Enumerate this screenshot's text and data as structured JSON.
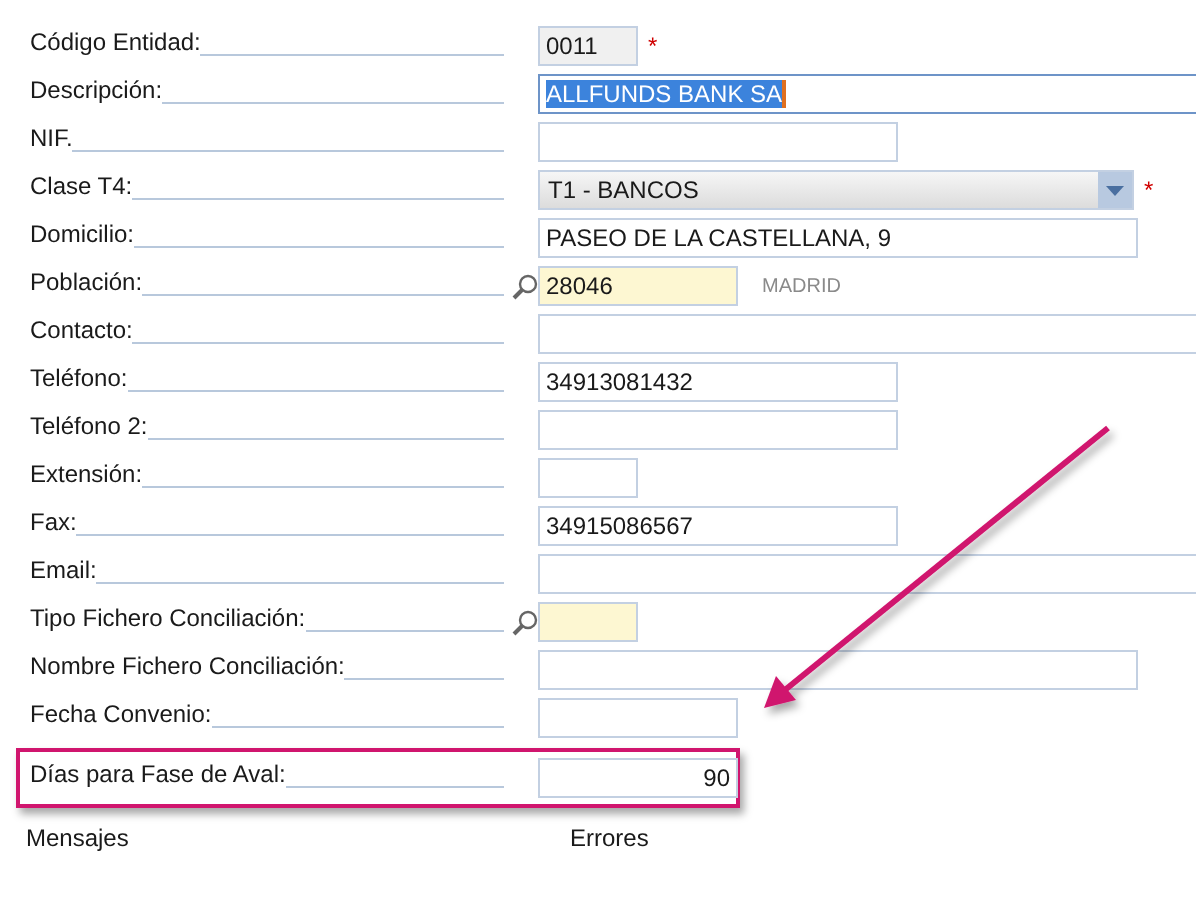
{
  "form": {
    "fields": [
      {
        "label": "Código Entidad:",
        "kind": "text",
        "value": "0011",
        "read_only": true,
        "marker": "*"
      },
      {
        "label": "Descripción:",
        "kind": "text",
        "value": "ALLFUNDS BANK SA",
        "selected": true
      },
      {
        "label": "NIF.",
        "kind": "text"
      },
      {
        "label": "Clase T4:",
        "kind": "select",
        "value": "T1 - BANCOS",
        "marker": "*"
      },
      {
        "label": "Domicilio:",
        "kind": "text",
        "value": "PASEO DE LA CASTELLANA, 9"
      },
      {
        "label": "Población:",
        "kind": "lookup",
        "value": "28046",
        "note": "MADRID"
      },
      {
        "label": "Contacto:",
        "kind": "text"
      },
      {
        "label": "Teléfono:",
        "kind": "text",
        "value": "34913081432"
      },
      {
        "label": "Teléfono 2:",
        "kind": "text"
      },
      {
        "label": "Extensión:",
        "kind": "text"
      },
      {
        "label": "Fax:",
        "kind": "text",
        "value": "34915086567"
      },
      {
        "label": "Email:",
        "kind": "text"
      },
      {
        "label": "Tipo Fichero Conciliación:",
        "kind": "lookup"
      },
      {
        "label": "Nombre Fichero Conciliación:",
        "kind": "text"
      },
      {
        "label": "Fecha Convenio:",
        "kind": "text"
      },
      {
        "label": "Días para Fase de Aval:",
        "kind": "number",
        "value": "90",
        "highlighted": true
      }
    ]
  },
  "footer": {
    "left": "Mensajes",
    "right": "Errores"
  }
}
